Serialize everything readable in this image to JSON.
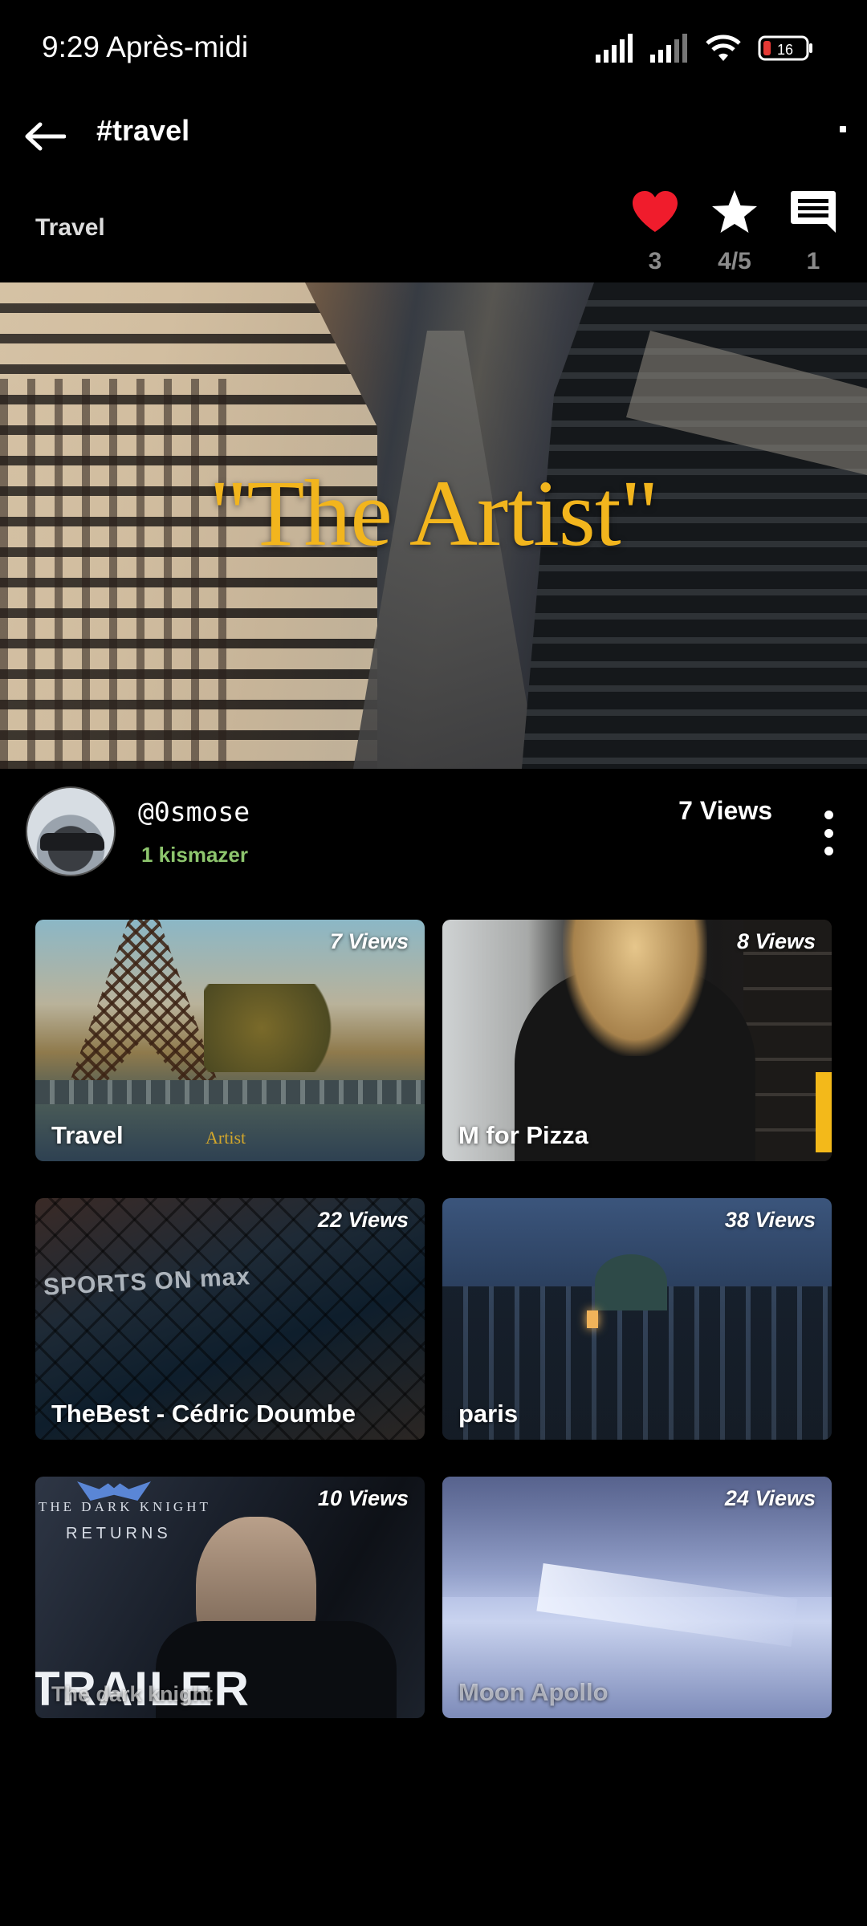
{
  "status_bar": {
    "time": "9:29 Après-midi",
    "battery": "16",
    "battery_color": "#e53935"
  },
  "header": {
    "title": "#travel",
    "back_icon": "arrow-left-icon"
  },
  "category": "Travel",
  "actions": {
    "likes": "3",
    "rating": "4/5",
    "comments": "1",
    "like_color": "#f01c2c"
  },
  "hero": {
    "title": "\"The Artist\"",
    "title_color": "#f2b51d"
  },
  "author": {
    "name": "@0smose",
    "subtitle": "1 kismazer",
    "views": "7 Views",
    "subtitle_color": "#8dc56d"
  },
  "videos": [
    {
      "views": "7 Views",
      "label": "Travel",
      "overlay": "Artist"
    },
    {
      "views": "8 Views",
      "label": "M for Pizza"
    },
    {
      "views": "22 Views",
      "label": "TheBest - Cédric Doumbe",
      "overlay": "SPORTS ON max"
    },
    {
      "views": "38 Views",
      "label": "paris"
    },
    {
      "views": "10 Views",
      "label": "The dark knight",
      "overlay_top": "THE DARK KNIGHT",
      "overlay_mid": "RETURNS",
      "overlay_bottom": "TRAILER"
    },
    {
      "views": "24 Views",
      "label": "Moon Apollo"
    }
  ]
}
